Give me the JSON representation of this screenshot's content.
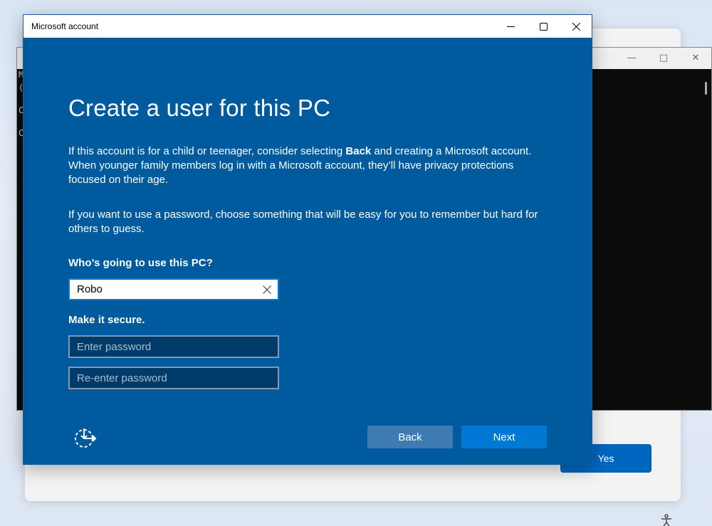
{
  "background": {
    "yes_label": "Yes",
    "console_lines": [
      "M",
      "(",
      "C",
      "C"
    ]
  },
  "window": {
    "title": "Microsoft account",
    "controls": {
      "minimize": "minimize-icon",
      "maximize": "maximize-icon",
      "close": "close-icon"
    }
  },
  "page": {
    "heading": "Create a user for this PC",
    "para1_before": "If this account is for a child or teenager, consider selecting ",
    "para1_bold": "Back",
    "para1_after": " and creating a Microsoft account. When younger family members log in with a Microsoft account, they’ll have privacy protections focused on their age.",
    "para2": "If you want to use a password, choose something that will be easy for you to remember but hard for others to guess.",
    "who_label": "Who’s going to use this PC?",
    "username_value": "Robo",
    "secure_label": "Make it secure.",
    "password_placeholder": "Enter password",
    "reenter_placeholder": "Re-enter password"
  },
  "footer": {
    "ease_icon": "ease-of-access-icon",
    "back_label": "Back",
    "next_label": "Next"
  },
  "colors": {
    "dialog_bg": "#005a9e",
    "next_button": "#0078d4",
    "back_button": "#3e7bb4",
    "input_border_focus": "#0078d4"
  }
}
